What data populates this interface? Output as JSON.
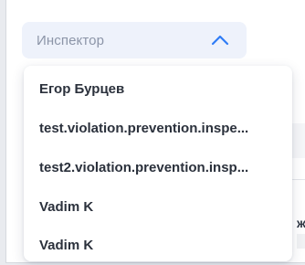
{
  "inspector_select": {
    "placeholder": "Инспектор",
    "expanded": true,
    "chevron_icon": "chevron-up-icon",
    "accent_color": "#2f7cf6",
    "field_background": "#eef2fb"
  },
  "dropdown": {
    "options": [
      {
        "label": "Егор Бурцев"
      },
      {
        "label": "test.violation.prevention.inspe..."
      },
      {
        "label": "test2.violation.prevention.insp..."
      },
      {
        "label": "Vadim K"
      },
      {
        "label": "Vadim K"
      }
    ]
  },
  "background": {
    "partial_text": "ж"
  }
}
